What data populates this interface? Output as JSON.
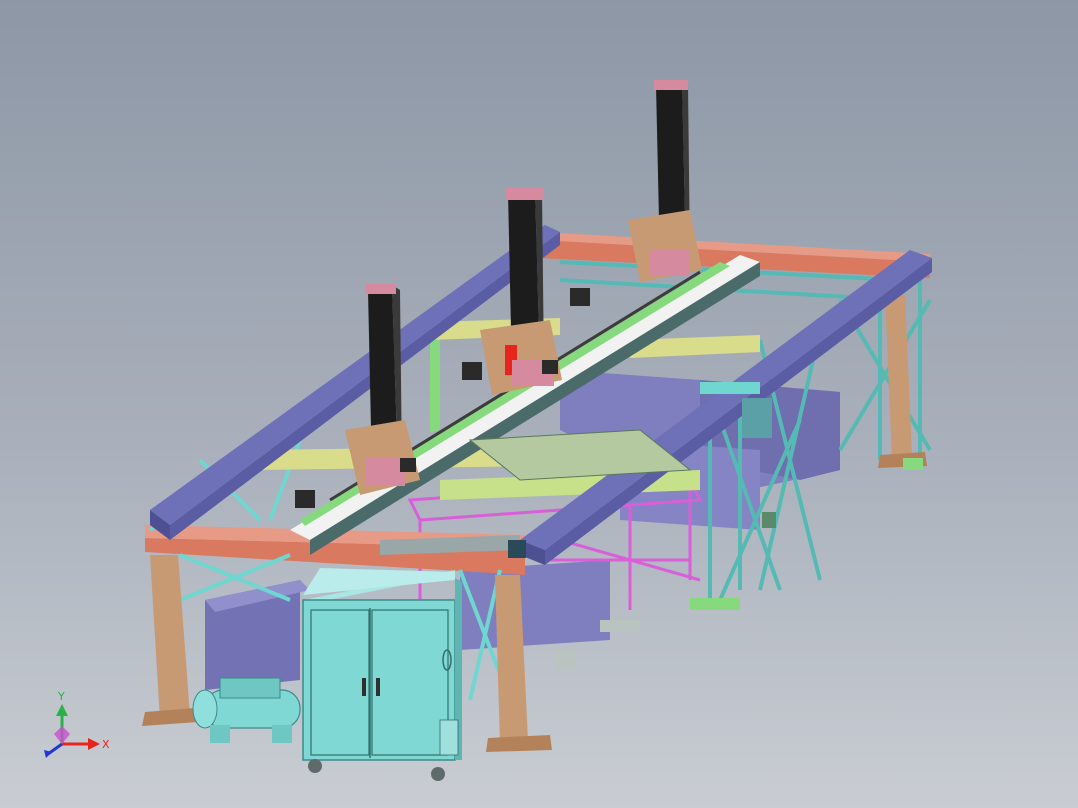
{
  "viewport": {
    "background_top": "#8d97a6",
    "background_bottom": "#c9cdd3"
  },
  "triad": {
    "x_label": "X",
    "y_label": "Y",
    "x_color": "#e8241e",
    "y_color": "#2ab24a",
    "z_color": "#2436d8"
  },
  "palette": {
    "beam_purple": "#6e70b8",
    "frame_cyan": "#6fd6d0",
    "frame_salmon": "#d9795f",
    "leg_tan": "#c89a73",
    "crossbar_yellow": "#d9dc8a",
    "column_black": "#1c1c1c",
    "cabinet_cyan": "#7fd8d4",
    "bin_lavender": "#7f7ebf",
    "table_magenta": "#d95fd9",
    "rail_white": "#f2f2f2",
    "carriage_pink": "#d58aa0",
    "green_part": "#86d97c"
  }
}
